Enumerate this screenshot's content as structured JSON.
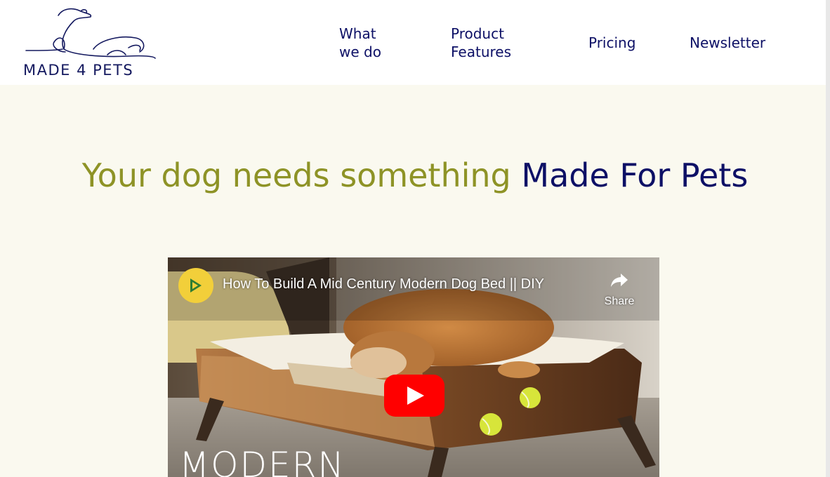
{
  "brand": {
    "logo_text": "MADE 4 PETS",
    "logo_icon": "greyhound-line-icon"
  },
  "nav": {
    "items": [
      {
        "line1": "What",
        "line2": "we do"
      },
      {
        "line1": "Product",
        "line2": "Features"
      },
      {
        "label": "Pricing"
      },
      {
        "label": "Newsletter"
      }
    ]
  },
  "hero": {
    "part1": "Your dog needs something",
    "part2": "Made For Pets",
    "colors": {
      "part1": "#8e9326",
      "part2": "#0d1066"
    }
  },
  "video": {
    "title": "How To Build A Mid Century Modern Dog Bed || DIY",
    "share_label": "Share",
    "overlay_text": "MODERN",
    "channel_icon": "channel-avatar-icon",
    "play_icon": "youtube-play-icon",
    "share_icon": "share-arrow-icon",
    "play_color": "#ff0000"
  }
}
